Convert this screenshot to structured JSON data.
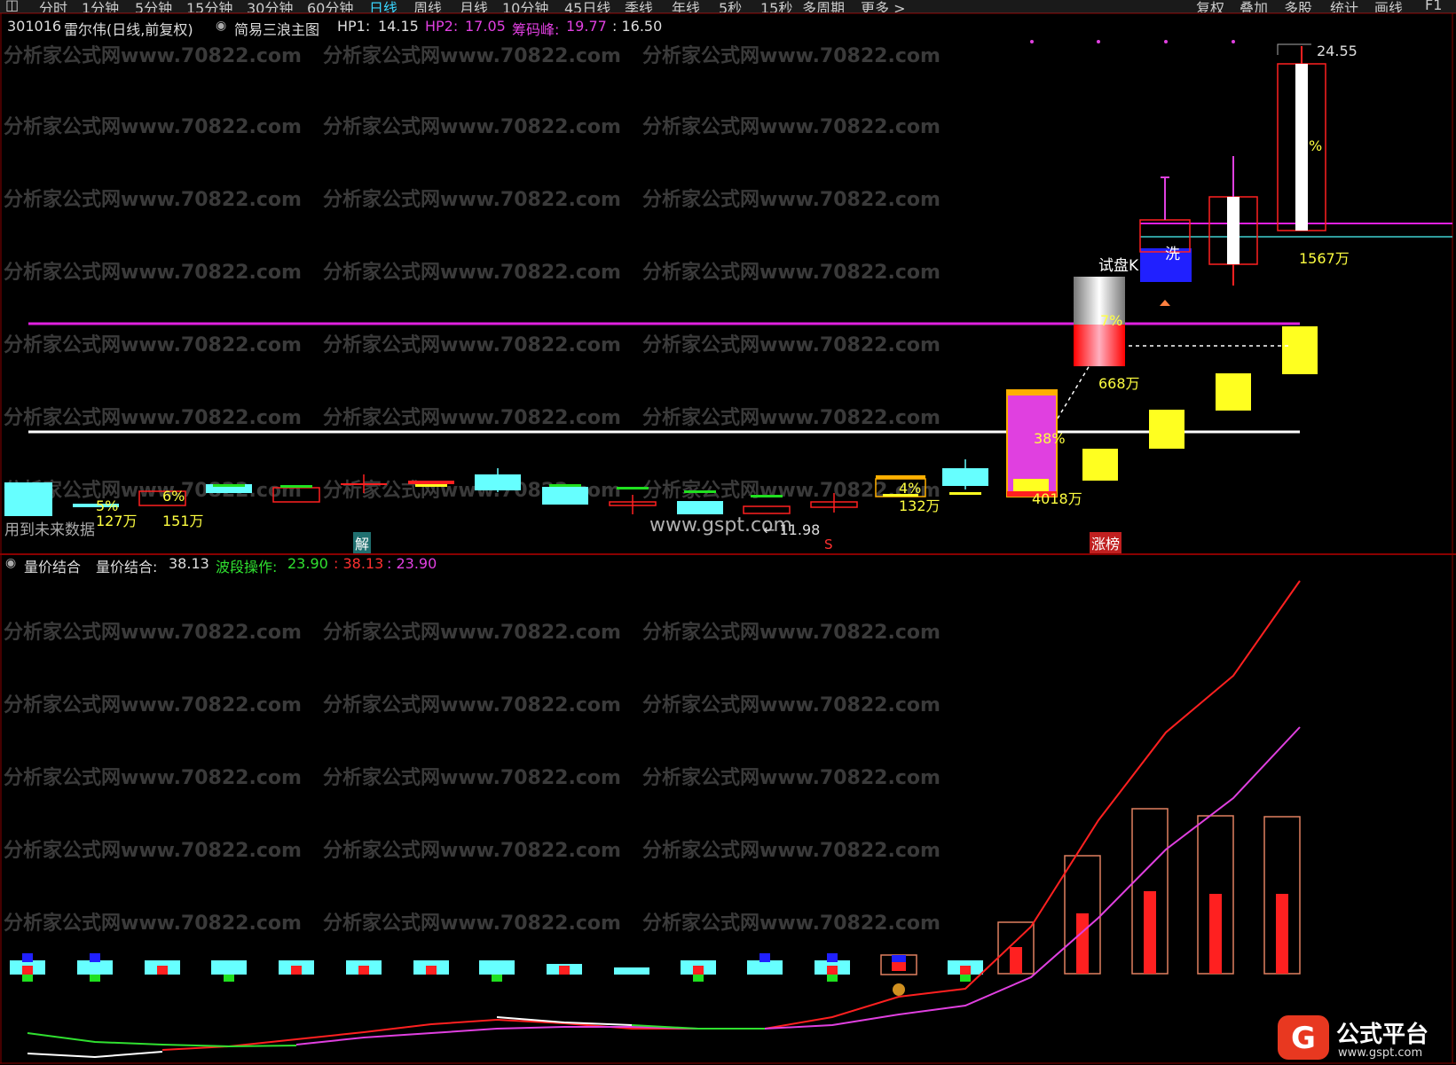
{
  "toolbar": {
    "left_icon": "panel-toggle-icon",
    "periods": [
      "分时",
      "1分钟",
      "5分钟",
      "15分钟",
      "30分钟",
      "60分钟",
      "日线",
      "周线",
      "月线",
      "10分钟",
      "45日线",
      "季线",
      "年线",
      "5秒",
      "15秒",
      "多周期",
      "更多 >"
    ],
    "active_period": "日线",
    "right_buttons": [
      "复权",
      "叠加",
      "多股",
      "统计",
      "画线",
      "F1"
    ]
  },
  "main_panel": {
    "stock_code": "301016",
    "stock_name": "雷尔伟(日线,前复权)",
    "indicator_name": "简易三浪主图",
    "hp1_label": "HP1:",
    "hp1_value": "14.15",
    "hp2_label": "HP2:",
    "hp2_value": "17.05",
    "chip_label": "筹码峰:",
    "chip_value": "19.77",
    "extra_value": ": 16.50",
    "high_price_label": "24.55",
    "low_price_label": "← 11.98",
    "future_data_note": "用到未来数据",
    "signal_jie": "解",
    "signal_s": "S",
    "signal_zhangbang": "涨榜",
    "signal_shipan": "试盘K",
    "signal_xi": "洗",
    "watermark_site": "www.gspt.com",
    "annotations": [
      {
        "text": "5%",
        "color": "#ffff40"
      },
      {
        "text": "127万",
        "color": "#ffff40"
      },
      {
        "text": "6%",
        "color": "#ffff40"
      },
      {
        "text": "151万",
        "color": "#ffff40"
      },
      {
        "text": "4%",
        "color": "#ffff40"
      },
      {
        "text": "132万",
        "color": "#ffff40"
      },
      {
        "text": "38%",
        "color": "#ffff40"
      },
      {
        "text": "4018万",
        "color": "#ffff40"
      },
      {
        "text": "7%",
        "color": "#ffff40"
      },
      {
        "text": "668万",
        "color": "#ffff40"
      },
      {
        "text": "%",
        "color": "#ffff40"
      },
      {
        "text": "1567万",
        "color": "#ffff40"
      }
    ]
  },
  "sub_panel": {
    "indicator_name": "量价结合",
    "lbl1": "量价结合:",
    "val1": "38.13",
    "lbl2": "波段操作:",
    "val2": "23.90",
    "val3": ": 38.13",
    "val4": ": 23.90"
  },
  "watermark_text": "分析家公式网www.70822.com",
  "brand": {
    "name": "公式平台",
    "url": "www.gspt.com",
    "logo_icon": "gspt-logo-icon"
  },
  "colors": {
    "cyan": "#66ffff",
    "red": "#ff2020",
    "green": "#20e020",
    "magenta": "#e040e0",
    "yellow": "#ffff20",
    "blue": "#2020ff",
    "white": "#ffffff",
    "accent_info_hp2": "#e040e0",
    "accent_info_green": "#30e030"
  }
}
